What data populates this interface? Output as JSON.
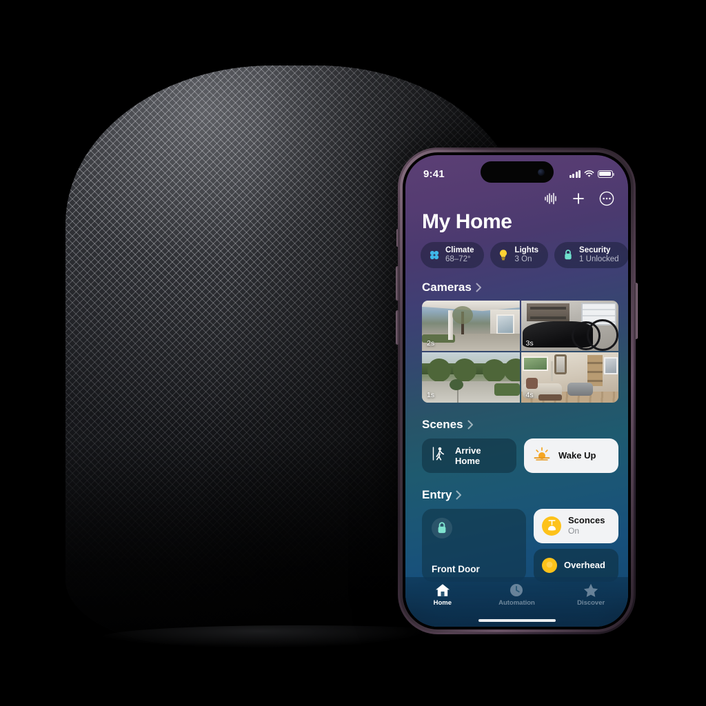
{
  "scene": {
    "background_color": "#000000",
    "device_label": "homepod-speaker"
  },
  "phone": {
    "frame_color": "#5b4659",
    "status_bar": {
      "time": "9:41",
      "cellular_icon": "cellular-bars-icon",
      "wifi_icon": "wifi-icon",
      "battery_icon": "battery-icon"
    },
    "toolbar": {
      "siri_waveform_icon": "audio-waveform-icon",
      "add_icon": "plus-icon",
      "more_icon": "ellipsis-circle-icon"
    },
    "title": "My Home",
    "status_chips": [
      {
        "icon": "fan-icon",
        "title": "Climate",
        "subtitle": "68–72°",
        "color": "#3fb7ea"
      },
      {
        "icon": "lightbulb-icon",
        "title": "Lights",
        "subtitle": "3 On",
        "color": "#ffd233"
      },
      {
        "icon": "lock-icon",
        "title": "Security",
        "subtitle": "1 Unlocked",
        "color": "#6fe0cc"
      }
    ],
    "sections": {
      "cameras": {
        "heading": "Cameras",
        "chevron_icon": "chevron-right-icon",
        "tiles": [
          {
            "name": "front-porch-camera",
            "timestamp": "2s"
          },
          {
            "name": "garage-camera",
            "timestamp": "3s"
          },
          {
            "name": "driveway-camera",
            "timestamp": "1s"
          },
          {
            "name": "living-room-camera",
            "timestamp": "4s"
          }
        ]
      },
      "scenes": {
        "heading": "Scenes",
        "chevron_icon": "chevron-right-icon",
        "items": [
          {
            "label": "Arrive Home",
            "icon": "walking-person-icon",
            "state": "off"
          },
          {
            "label": "Wake Up",
            "icon": "sunrise-icon",
            "state": "on"
          }
        ]
      },
      "entry": {
        "heading": "Entry",
        "chevron_icon": "chevron-right-icon",
        "lock_tile": {
          "label": "Front Door",
          "icon": "lock-icon",
          "icon_color": "#7fe3cf"
        },
        "accessories": [
          {
            "label": "Sconces",
            "state": "On",
            "icon": "pendant-light-icon",
            "state_on": true,
            "accent": "#fdc21a"
          },
          {
            "label": "Overhead",
            "state": "",
            "icon": "lightbulb-icon",
            "state_on": false,
            "accent": "#fdc21a"
          }
        ]
      }
    },
    "tab_bar": [
      {
        "label": "Home",
        "icon": "house-icon",
        "active": true
      },
      {
        "label": "Automation",
        "icon": "clock-icon",
        "active": false
      },
      {
        "label": "Discover",
        "icon": "star-icon",
        "active": false
      }
    ]
  }
}
